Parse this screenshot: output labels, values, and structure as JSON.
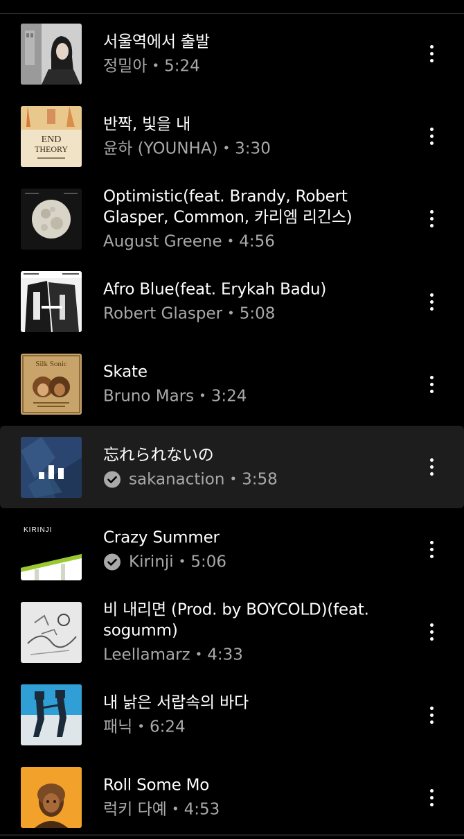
{
  "tracks": [
    {
      "title": "서울역에서 출발",
      "artist": "정밀아",
      "duration": "5:24",
      "verified": false,
      "playing": false,
      "art": "seoul"
    },
    {
      "title": "반짝, 빛을 내",
      "artist": "윤하 (YOUNHA)",
      "duration": "3:30",
      "verified": false,
      "playing": false,
      "art": "endtheory",
      "art_text": "END THEORY"
    },
    {
      "title": "Optimistic(feat. Brandy, Robert Glasper, Common, 카리엠 리긴스)",
      "artist": "August Greene",
      "duration": "4:56",
      "verified": false,
      "playing": false,
      "art": "moon"
    },
    {
      "title": "Afro Blue(feat. Erykah Badu)",
      "artist": "Robert Glasper",
      "duration": "5:08",
      "verified": false,
      "playing": false,
      "art": "afroblue"
    },
    {
      "title": "Skate",
      "artist": "Bruno Mars",
      "duration": "3:24",
      "verified": false,
      "playing": false,
      "art": "silksonic",
      "art_text": "Silk Sonic"
    },
    {
      "title": "忘れられないの",
      "artist": "sakanaction",
      "duration": "3:58",
      "verified": true,
      "playing": true,
      "art": "sakanaction"
    },
    {
      "title": "Crazy Summer",
      "artist": "Kirinji",
      "duration": "5:06",
      "verified": true,
      "playing": false,
      "art": "kirinji",
      "art_text": "KIRINJI"
    },
    {
      "title": "비 내리면 (Prod. by BOYCOLD)(feat. sogumm)",
      "artist": "Leellamarz",
      "duration": "4:33",
      "verified": false,
      "playing": false,
      "art": "sketch"
    },
    {
      "title": "내 낡은 서랍속의 바다",
      "artist": "패닉",
      "duration": "6:24",
      "verified": false,
      "playing": false,
      "art": "panic"
    },
    {
      "title": "Roll Some Mo",
      "artist": "럭키 다예",
      "duration": "4:53",
      "verified": false,
      "playing": false,
      "art": "lucky"
    }
  ],
  "separator": "•",
  "colors": {
    "background": "#000000",
    "active_row": "#1d1d1d",
    "title_text": "#ffffff",
    "subtitle_text": "#a9a9a9"
  },
  "icons": {
    "more": "more-vert-icon",
    "verified": "verified-check-icon",
    "playing": "equalizer-icon"
  }
}
